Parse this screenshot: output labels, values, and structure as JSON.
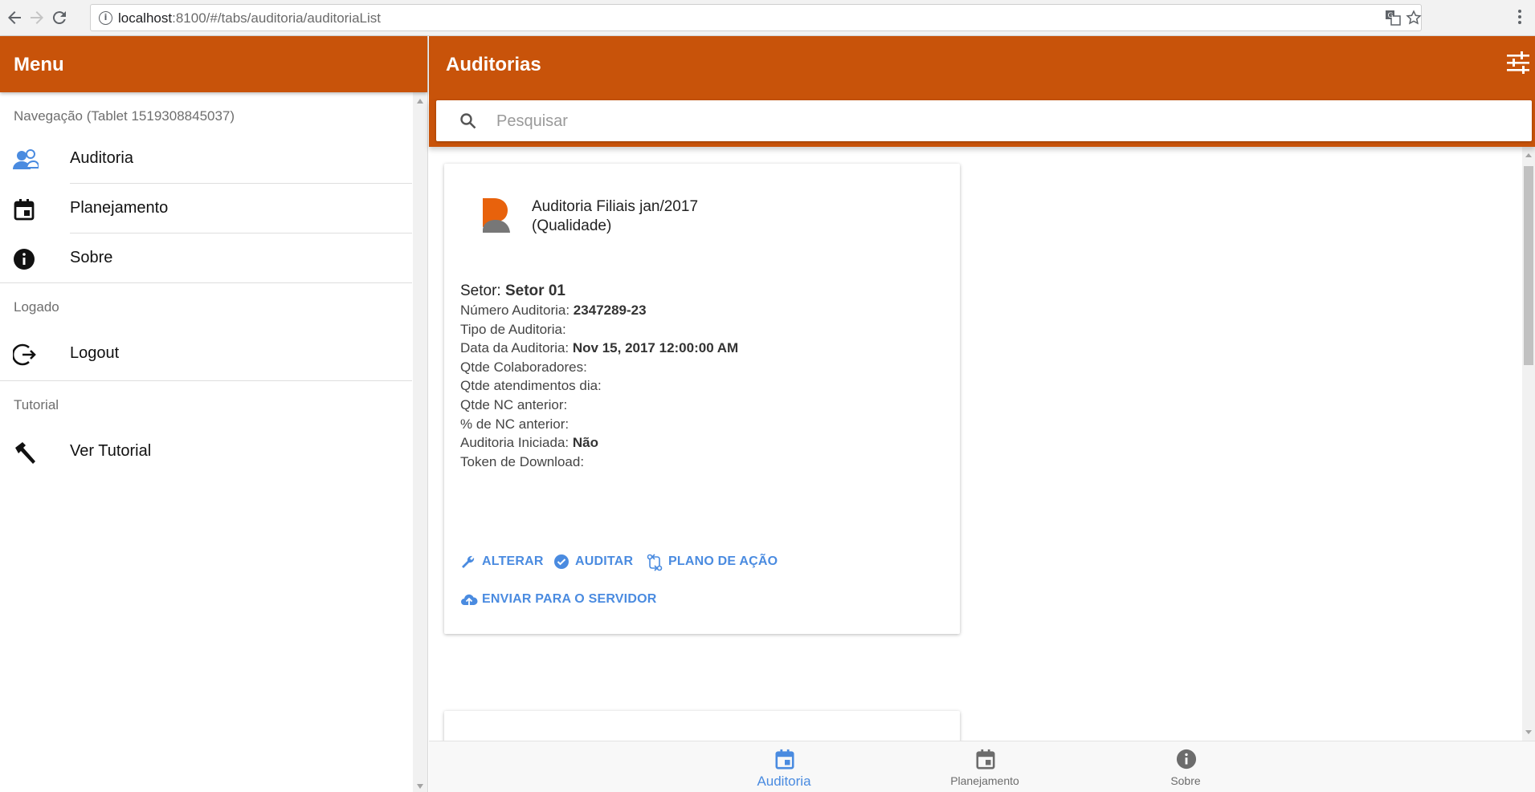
{
  "browser": {
    "url_host": "localhost",
    "url_path": ":8100/#/tabs/auditoria/auditoriaList"
  },
  "side_menu": {
    "title": "Menu",
    "sections": [
      {
        "header": "Navegação (Tablet 1519308845037)"
      },
      {
        "header": "Logado"
      },
      {
        "header": "Tutorial"
      }
    ],
    "items": [
      {
        "label": "Auditoria",
        "icon": "people-icon"
      },
      {
        "label": "Planejamento",
        "icon": "calendar-icon"
      },
      {
        "label": "Sobre",
        "icon": "info-icon"
      },
      {
        "label": "Logout",
        "icon": "logout-icon"
      },
      {
        "label": "Ver Tutorial",
        "icon": "hammer-icon"
      }
    ]
  },
  "main": {
    "title": "Auditorias",
    "search": {
      "placeholder": "Pesquisar",
      "value": ""
    },
    "card": {
      "title_line1": "Auditoria Filiais jan/2017",
      "title_line2": "(Qualidade)",
      "fields": [
        {
          "label": "Setor: ",
          "value": "Setor 01"
        },
        {
          "label": "Número Auditoria: ",
          "value": "2347289-23"
        },
        {
          "label": "Tipo de Auditoria:",
          "value": ""
        },
        {
          "label": "Data da Auditoria: ",
          "value": "Nov 15, 2017 12:00:00 AM"
        },
        {
          "label": "Qtde Colaboradores:",
          "value": ""
        },
        {
          "label": "Qtde atendimentos dia:",
          "value": ""
        },
        {
          "label": "Qtde NC anterior:",
          "value": ""
        },
        {
          "label": "% de NC anterior:",
          "value": ""
        },
        {
          "label": "Auditoria Iniciada: ",
          "value": "Não"
        },
        {
          "label": "Token de Download:",
          "value": ""
        }
      ],
      "actions": {
        "alterar": "ALTERAR",
        "auditar": "AUDITAR",
        "plano": "PLANO DE AÇÃO",
        "enviar": "ENVIAR PARA O SERVIDOR"
      }
    },
    "tabs": [
      {
        "label": "Auditoria",
        "active": true
      },
      {
        "label": "Planejamento",
        "active": false
      },
      {
        "label": "Sobre",
        "active": false
      }
    ]
  },
  "colors": {
    "toolbar": "#c8530a",
    "accent": "#4a8be0",
    "logo_orange": "#e8620c",
    "logo_gray": "#777777"
  }
}
